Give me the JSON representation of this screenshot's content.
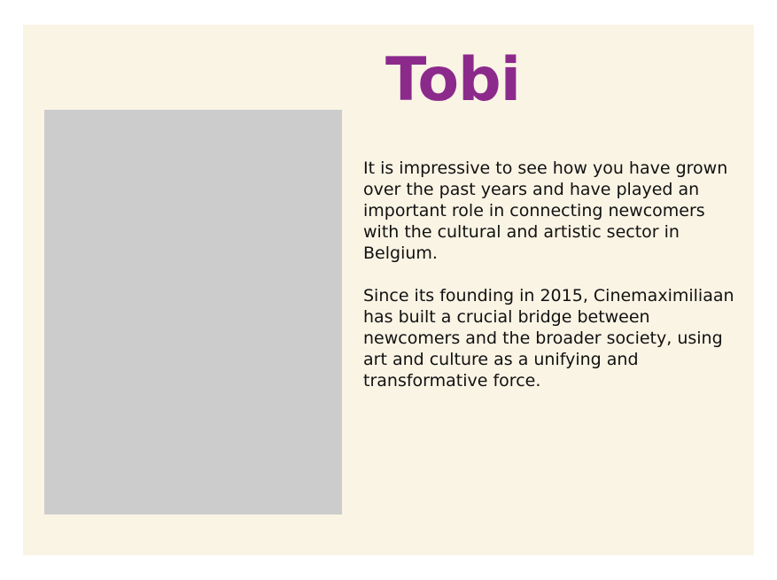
{
  "profile": {
    "name": "Tobi",
    "paragraphs": [
      "It is impressive to see how you have grown over the past years and have played an important role in connecting newcomers with the cultural and artistic sector in Belgium.",
      "Since its founding in 2015, Cinemaximiliaan has built a crucial bridge between newcomers and the broader society, using art and culture as a unifying and transformative force."
    ]
  },
  "colors": {
    "background": "#faf4e5",
    "name": "#8c2a8c",
    "photo_placeholder": "#cccccc",
    "text": "#111111"
  }
}
